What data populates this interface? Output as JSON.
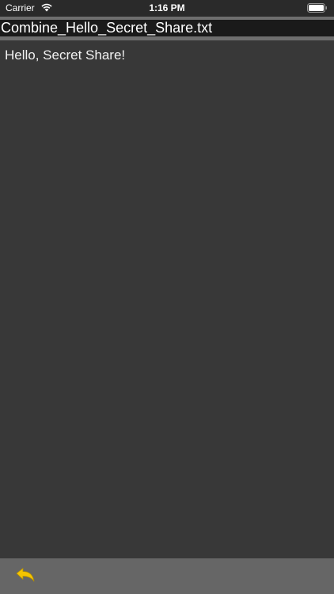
{
  "status_bar": {
    "carrier": "Carrier",
    "time": "1:16 PM",
    "wifi_icon": "wifi-icon",
    "battery_icon": "battery-icon"
  },
  "document": {
    "file_name": "Combine_Hello_Secret_Share.txt",
    "content": "Hello, Secret Share!"
  },
  "toolbar": {
    "back_icon": "reply-arrow-icon",
    "accent_color": "#f5c400"
  },
  "colors": {
    "background": "#383838",
    "title_bar": "#1a1a1a",
    "toolbar": "#666666",
    "text": "#f2f2f2"
  }
}
